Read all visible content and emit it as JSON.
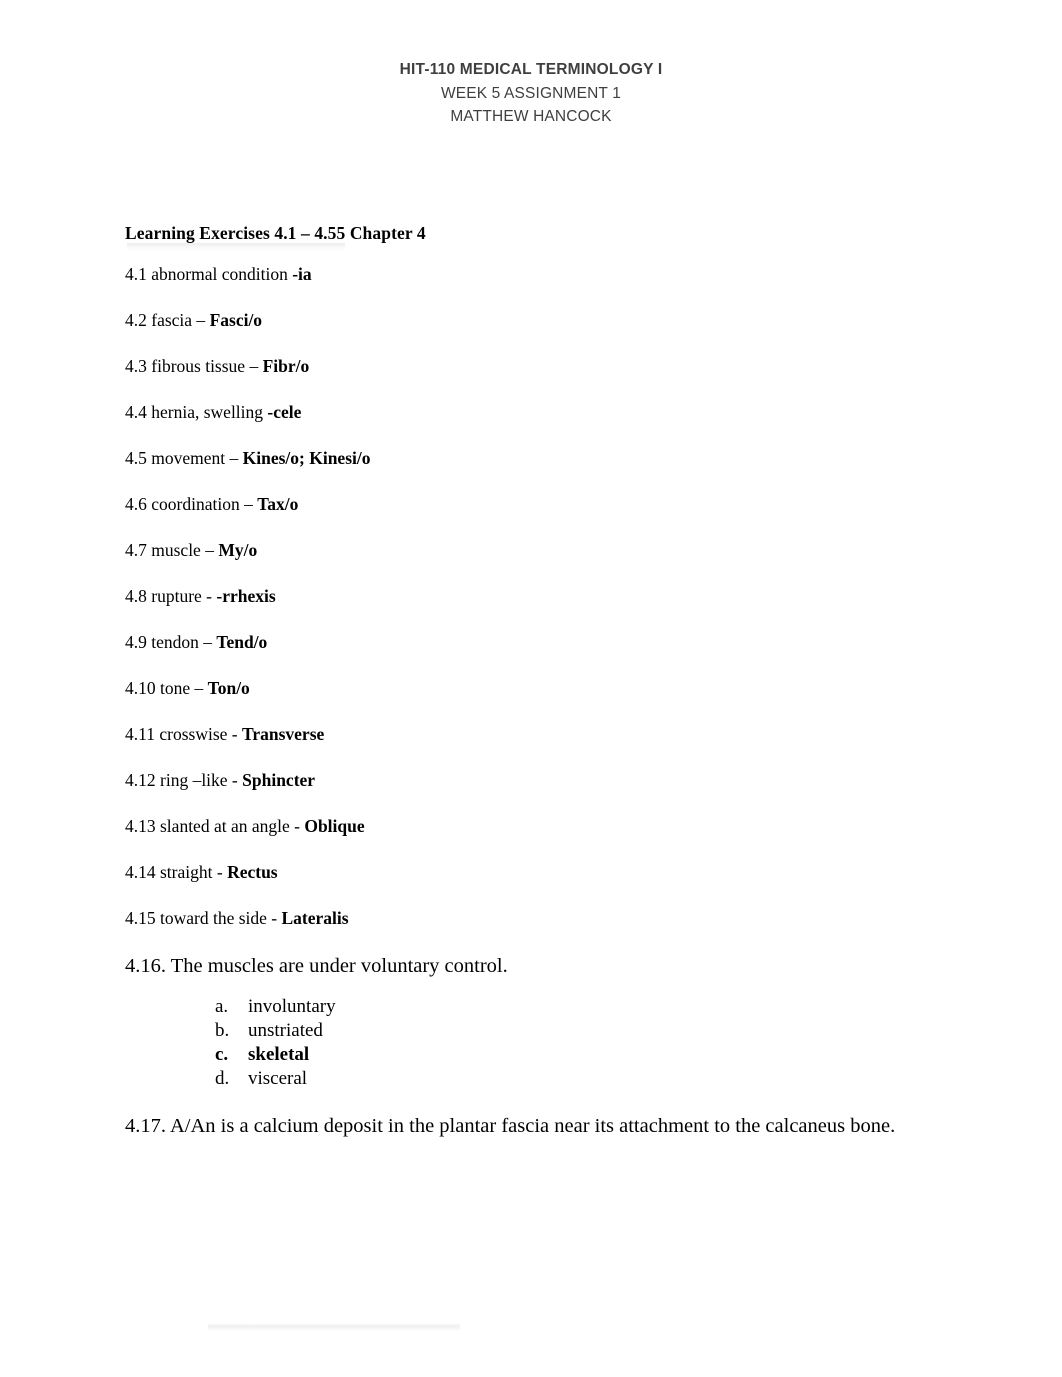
{
  "header": {
    "title": "HIT-110 MEDICAL TERMINOLOGY I",
    "assignment": "WEEK 5 ASSIGNMENT 1",
    "author": "MATTHEW HANCOCK",
    "color": "#3f3f3f"
  },
  "document": {
    "section_heading": "Learning Exercises 4.1 – 4.55 Chapter 4",
    "exercises": [
      {
        "prompt": "4.1 abnormal condition ",
        "answer": "-ia"
      },
      {
        "prompt": "4.2 fascia – ",
        "answer": "Fasci/o"
      },
      {
        "prompt": "4.3 fibrous tissue – ",
        "answer": "Fibr/o"
      },
      {
        "prompt": "4.4 hernia, swelling ",
        "answer": "-cele"
      },
      {
        "prompt": "4.5 movement – ",
        "answer": "Kines/o; Kinesi/o"
      },
      {
        "prompt": "4.6 coordination – ",
        "answer": "Tax/o"
      },
      {
        "prompt": "4.7 muscle – ",
        "answer": "My/o"
      },
      {
        "prompt": "4.8 rupture - ",
        "answer": "-rrhexis"
      },
      {
        "prompt": "4.9 tendon – ",
        "answer": "Tend/o"
      },
      {
        "prompt": "4.10 tone – ",
        "answer": "Ton/o"
      },
      {
        "prompt": "4.11 crosswise - ",
        "answer": "Transverse"
      },
      {
        "prompt": "4.12 ring –like - ",
        "answer": "Sphincter"
      },
      {
        "prompt": "4.13 slanted at an angle - ",
        "answer": "Oblique"
      },
      {
        "prompt": "4.14 straight - ",
        "answer": "Rectus"
      },
      {
        "prompt": "4.15 toward the side - ",
        "answer": "Lateralis"
      }
    ],
    "question_16": {
      "text": "4.16. The muscles are under voluntary control.",
      "choices": [
        {
          "marker": "a.",
          "text": "involuntary",
          "selected": false
        },
        {
          "marker": "b.",
          "text": "unstriated",
          "selected": false
        },
        {
          "marker": "c.",
          "text": "skeletal",
          "selected": true
        },
        {
          "marker": "d.",
          "text": "visceral",
          "selected": false
        }
      ]
    },
    "question_17": {
      "text": "4.17. A/An is a calcium deposit in the plantar fascia near its attachment to the calcaneus bone."
    }
  }
}
